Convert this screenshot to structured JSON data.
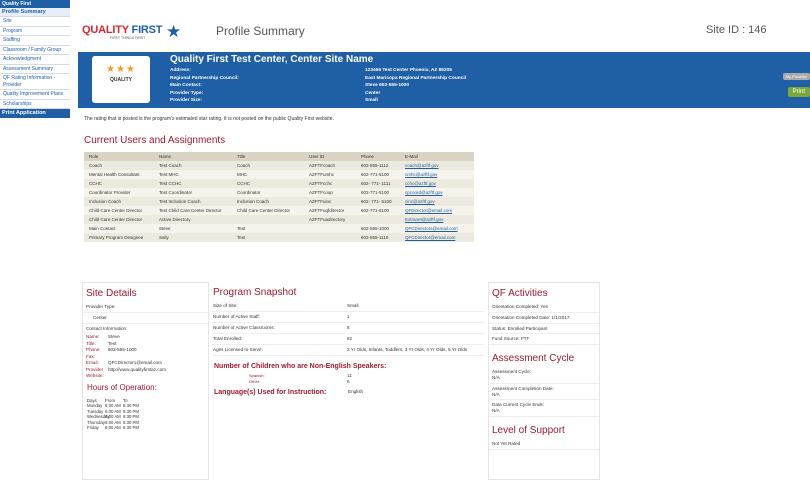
{
  "nav": {
    "section": "Quality First",
    "head": "Profile Summary",
    "items": [
      "Site",
      "Program",
      "Staffing",
      "Classroom / Family Group",
      "Acknowledgment",
      "Assessment Summary",
      "QF Rating Information - Provider",
      "Quality Improvement Plans",
      "Scholarships"
    ],
    "print": "Print Application"
  },
  "header": {
    "logo_main": "QUALITY",
    "logo_accent": "FIRST",
    "logo_tag": "FIRST THINGS FIRST",
    "title": "Profile Summary",
    "site_id": "Site ID : 146"
  },
  "band": {
    "stars": "★★★",
    "badge_text": "QUALITY",
    "center_name": "Quality First Test Center, Center Site Name",
    "fields": [
      "Address:",
      "Regional Partnership Council:",
      "Main Contact:",
      "Provider Type:",
      "Provider Size:"
    ],
    "values": [
      "123456 Test Center Phoenix, AZ 85205",
      "East Maricopa Regional Partnership Council",
      "Steve 602-555-1000",
      "Center",
      "Small"
    ],
    "btn_provider": "My Provider",
    "btn_print": "Print"
  },
  "note": "The rating that is posted is the program's estimated star rating. It is not posted on the public Quality First website.",
  "users": {
    "title": "Current Users and Assignments",
    "headers": [
      "Role",
      "Name",
      "Title",
      "User ID",
      "Phone",
      "E-Mail"
    ],
    "rows": [
      [
        "Coach",
        "Test Coach",
        "Coach",
        "AZFTFcoach",
        "602-555-1112",
        "coach@azftf.gov"
      ],
      [
        "Mental Health Consultant",
        "Test MHC",
        "MHC",
        "AZFTFumhc",
        "602-771-5100",
        "cmhc@azftf.gov"
      ],
      [
        "CCHC",
        "Test CCHC",
        "CCHC",
        "AZFTFcchc",
        "602- 771- 1111",
        "cchc@azftf.gov"
      ],
      [
        "Coordinator Provider",
        "Test Coordinator",
        "Coordinator",
        "AZFTFcoop",
        "602-771-5100",
        "cpcoord@azftf.gov"
      ],
      [
        "Inclusion Coach",
        "Test Inclusion Coach",
        "Inclusion Coach",
        "AZFTFuinc",
        "602- 771- 5100",
        "cinc@azftf.gov"
      ],
      [
        "Child Care Center Director",
        "Test Child Care Center Director",
        "Child Care Center Director",
        "AZFTFuqfdirector",
        "602-771-5100",
        "QFDirector@email.com"
      ],
      [
        "Child Care Center Director",
        "Active Directory",
        "",
        "AZFTFuadirectory",
        "",
        "Extranet@azftf.gov"
      ],
      [
        "Main Contact",
        "Steve",
        "Test",
        "",
        "602-555-1000",
        "QFCDirectors@email.com"
      ],
      [
        "Primary Program Designee",
        "Sally",
        "Test",
        "",
        "602-555-1110",
        "QFCDirector@email.com"
      ]
    ]
  },
  "site": {
    "title": "Site Details",
    "provider_type_label": "Provider Type:",
    "provider_type": "Center",
    "contact_label": "Contact Information:",
    "contact": [
      {
        "k": "Name:",
        "v": "Steve"
      },
      {
        "k": "Title:",
        "v": "Test"
      },
      {
        "k": "Phone:",
        "v": "602-555-1000"
      },
      {
        "k": "Fax:",
        "v": ""
      },
      {
        "k": "Email:",
        "v": "QFCDirector1@email.com"
      },
      {
        "k": "Provider Website:",
        "v": "http://www.qualityfirstaz.com"
      }
    ],
    "hours_title": "Hours of Operation:",
    "hours_head": [
      "Days",
      "From",
      "To"
    ],
    "hours": [
      [
        "Monday",
        "6:00 AM",
        "6:30 PM"
      ],
      [
        "Tuesday",
        "6:00 AM",
        "6:30 PM"
      ],
      [
        "Wednesday",
        "6:00 AM",
        "6:30 PM"
      ],
      [
        "Thursday",
        "6:00 AM",
        "6:30 PM"
      ],
      [
        "Friday",
        "6:00 AM",
        "6:30 PM"
      ]
    ]
  },
  "program": {
    "title": "Program Snapshot",
    "rows": [
      [
        "Size of Site:",
        "Small"
      ],
      [
        "Number of Active Staff:",
        "1"
      ],
      [
        "Number of Active Classrooms:",
        "6"
      ],
      [
        "Total Enrolled:",
        "82"
      ],
      [
        "Ages Licensed to Serve:",
        "2 Yr Olds, Infants, Toddlers, 3 Yr Olds, 4 Yr Olds, 5 Yr Olds"
      ]
    ],
    "nes_title": "Number of Children who are Non-English Speakers:",
    "nes": [
      [
        "Spanish:",
        "11"
      ],
      [
        "Other:",
        "6"
      ]
    ],
    "lang_label": "Language(s) Used for Instruction:",
    "lang_value": "English"
  },
  "qf": {
    "title": "QF Activities",
    "rows": [
      "Orientation Completed: Yes",
      "Orientation Completed Date: 1/1/2017",
      "Status: Enrolled Participant",
      "Fund Source: FTF"
    ],
    "assess_title": "Assessment Cycle",
    "assess_rows": [
      "Assessment Cycle:\nN/A",
      "Assessment Completion Date:\nN/A",
      "Data Current Cycle Ends:\nN/A"
    ],
    "support_title": "Level of Support",
    "support_value": "Not Yet Rated"
  }
}
